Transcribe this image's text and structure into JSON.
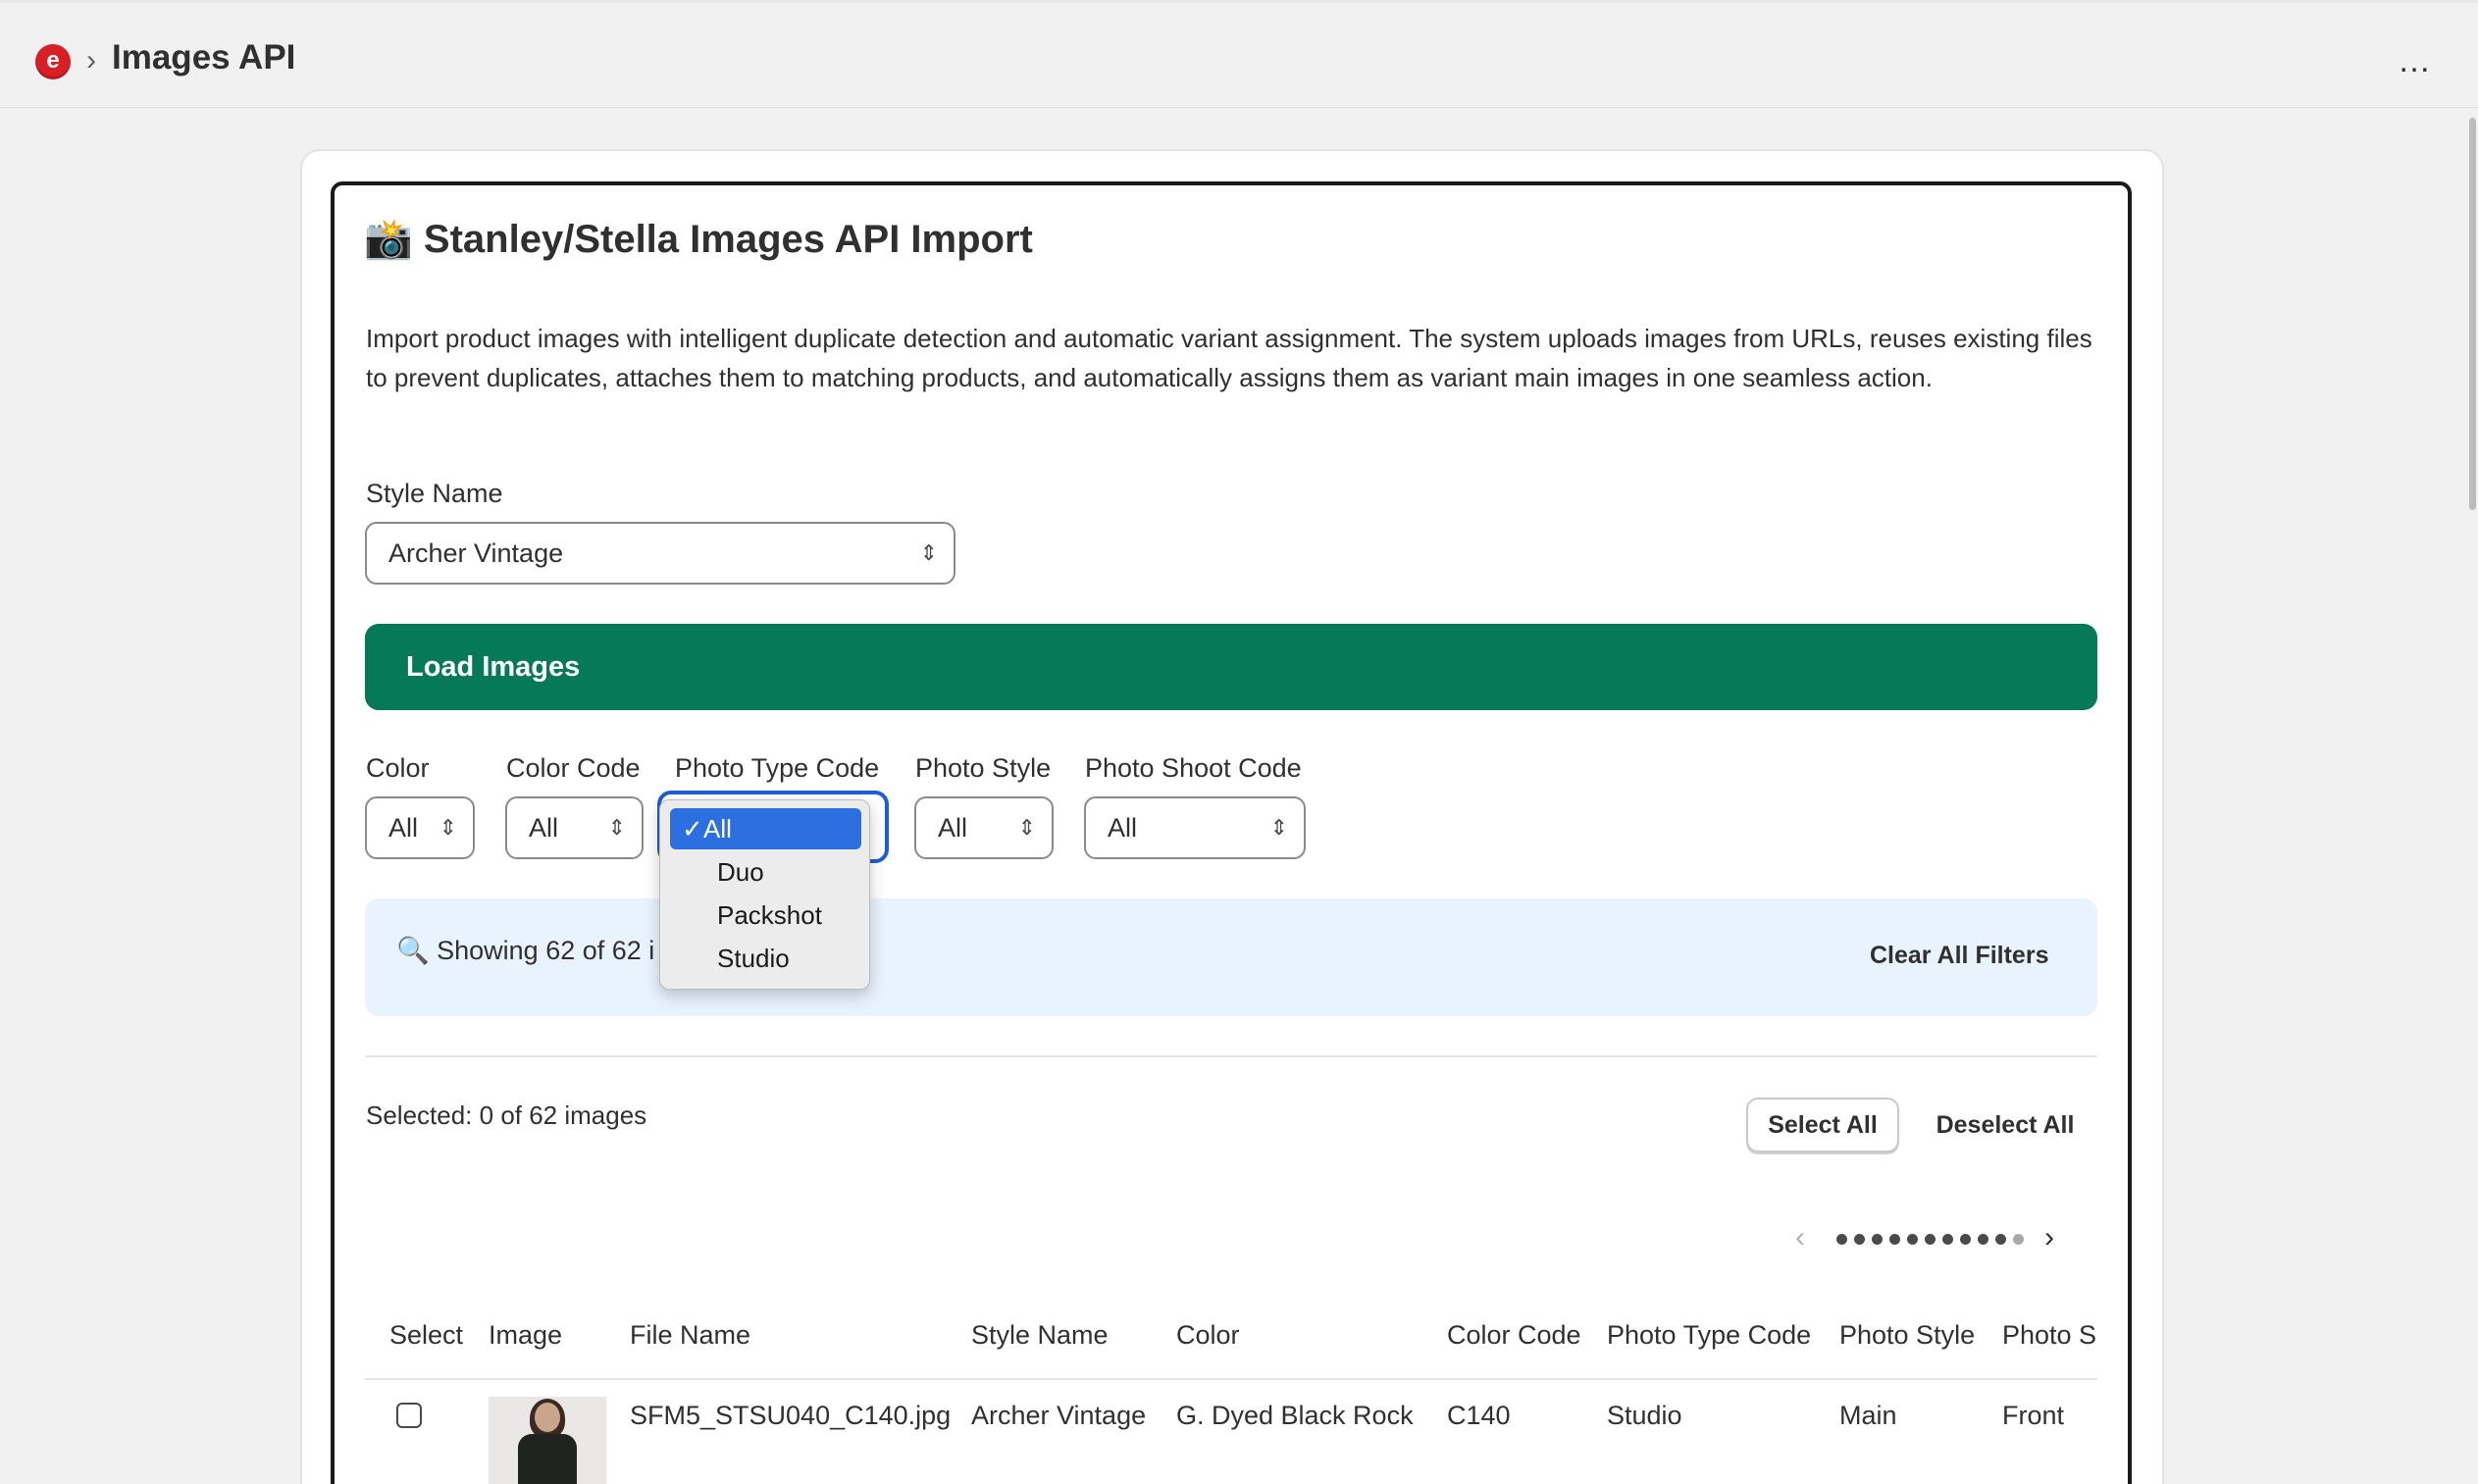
{
  "header": {
    "breadcrumb_separator": "›",
    "title": "Images API",
    "app_logo_letter": "e",
    "more_icon": "…"
  },
  "card": {
    "heading": "📸 Stanley/Stella Images API Import",
    "description": "Import product images with intelligent duplicate detection and automatic variant assignment. The system uploads images from URLs, reuses existing files to prevent duplicates, attaches them to matching products, and automatically assigns them as variant main images in one seamless action.",
    "style_name_label": "Style Name",
    "style_name_value": "Archer Vintage",
    "load_button": "Load Images"
  },
  "filters": {
    "color": {
      "label": "Color",
      "value": "All"
    },
    "color_code": {
      "label": "Color Code",
      "value": "All"
    },
    "photo_type_code": {
      "label": "Photo Type Code",
      "value": "All",
      "options": [
        "All",
        "Duo",
        "Packshot",
        "Studio"
      ],
      "check": "✓"
    },
    "photo_style": {
      "label": "Photo Style",
      "value": "All"
    },
    "photo_shoot_code": {
      "label": "Photo Shoot Code",
      "value": "All"
    }
  },
  "info_banner": {
    "text": "🔍 Showing 62 of 62 i",
    "clear_button": "Clear All Filters"
  },
  "selection": {
    "status": "Selected: 0 of 62 images",
    "select_all": "Select All",
    "deselect_all": "Deselect All"
  },
  "pagination": {
    "prev": "‹",
    "next": "›",
    "dot_count": 11,
    "active_dots": 10
  },
  "table": {
    "headers": [
      "Select",
      "Image",
      "File Name",
      "Style Name",
      "Color",
      "Color Code",
      "Photo Type Code",
      "Photo Style",
      "Photo S"
    ],
    "rows": [
      {
        "file_name": "SFM5_STSU040_C140.jpg",
        "style_name": "Archer Vintage",
        "color": "G. Dyed Black Rock",
        "color_code": "C140",
        "photo_type_code": "Studio",
        "photo_style": "Main",
        "photo_shoot": "Front"
      }
    ]
  },
  "colors": {
    "primary_button": "#067a56",
    "info_banner": "#e9f3fe",
    "focus": "#1f5dd6",
    "selected_option": "#2c6fe0",
    "logo": "#d91f26"
  }
}
